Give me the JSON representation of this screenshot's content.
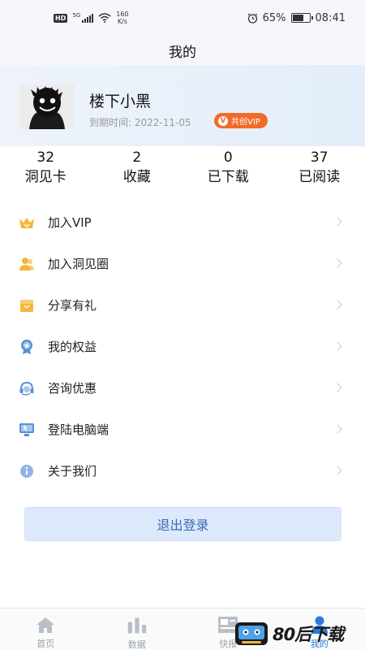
{
  "status_bar": {
    "network_type": "HD",
    "signal_label": "5G",
    "net_speed_value": "160",
    "net_speed_unit": "K/s",
    "battery": "65%",
    "battery_level": 0.65,
    "time": "08:41"
  },
  "header": {
    "title": "我的"
  },
  "profile": {
    "username": "楼下小黑",
    "expiry_label": "到期时间:",
    "expiry_date": "2022-11-05",
    "vip_badge": "共创VIP"
  },
  "stats": [
    {
      "value": "32",
      "label": "洞见卡"
    },
    {
      "value": "2",
      "label": "收藏"
    },
    {
      "value": "0",
      "label": "已下载"
    },
    {
      "value": "37",
      "label": "已阅读"
    }
  ],
  "menu": [
    {
      "label": "加入VIP",
      "icon": "crown-icon"
    },
    {
      "label": "加入洞见圈",
      "icon": "group-icon"
    },
    {
      "label": "分享有礼",
      "icon": "gift-icon"
    },
    {
      "label": "我的权益",
      "icon": "badge-icon"
    },
    {
      "label": "咨询优惠",
      "icon": "headset-icon"
    },
    {
      "label": "登陆电脑端",
      "icon": "monitor-icon"
    },
    {
      "label": "关于我们",
      "icon": "info-icon"
    }
  ],
  "logout_label": "退出登录",
  "tabs": [
    {
      "label": "首页",
      "icon": "home-icon"
    },
    {
      "label": "数据",
      "icon": "bar-chart-icon"
    },
    {
      "label": "快报",
      "icon": "news-icon"
    },
    {
      "label": "我的",
      "icon": "person-icon",
      "active": true
    }
  ],
  "watermark": {
    "text": "80后下载"
  },
  "colors": {
    "accent": "#2b7bd8",
    "vip_orange": "#f26a2a",
    "icon_yellow": "#f5b63c",
    "icon_blue": "#5b8fd6"
  }
}
